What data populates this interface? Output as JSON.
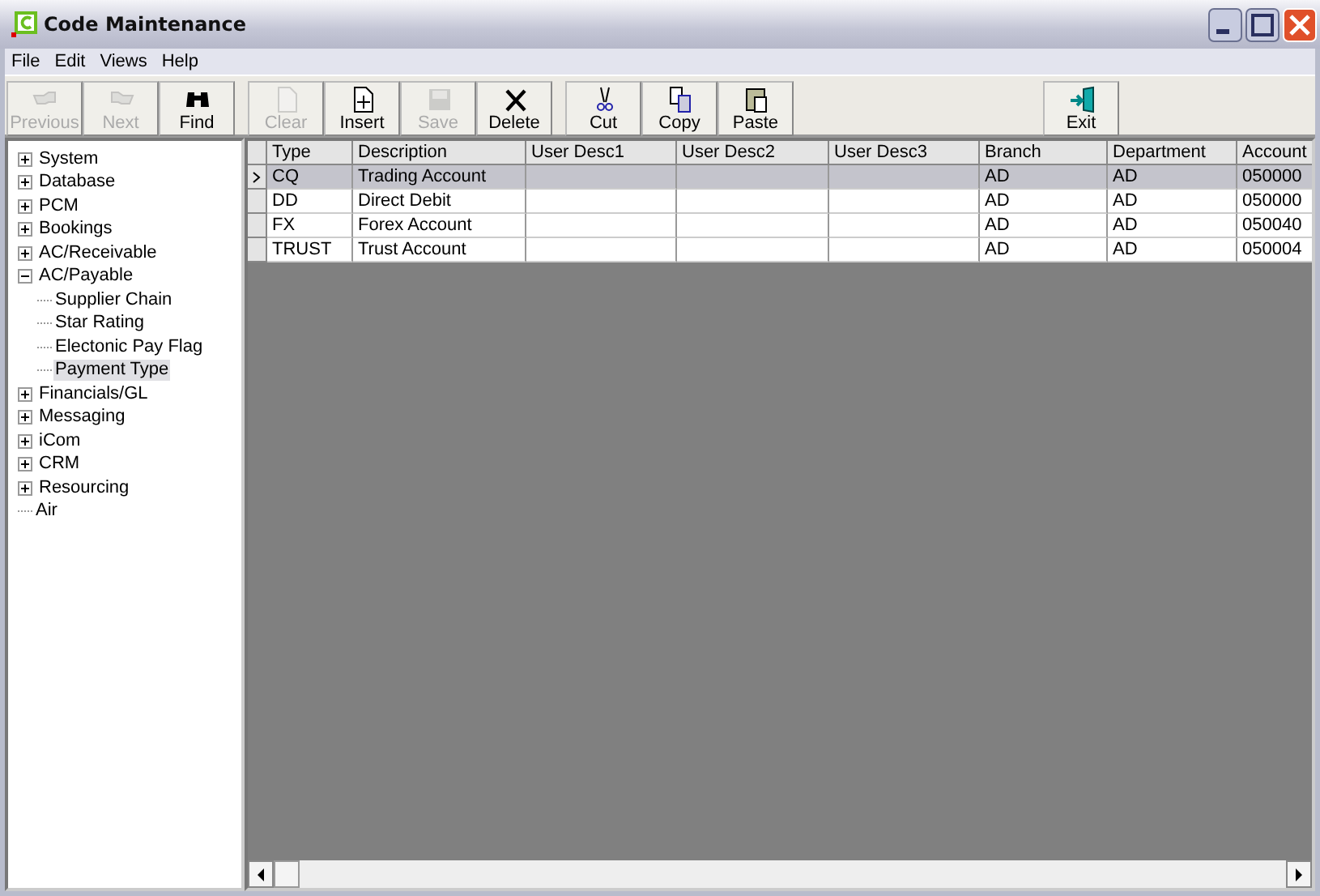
{
  "window": {
    "title": "Code Maintenance"
  },
  "menu": [
    "File",
    "Edit",
    "Views",
    "Help"
  ],
  "toolbar": [
    [
      {
        "label": "Previous",
        "disabled": true
      },
      {
        "label": "Next",
        "disabled": true
      },
      {
        "label": "Find",
        "disabled": false
      }
    ],
    [
      {
        "label": "Clear",
        "disabled": true
      },
      {
        "label": "Insert",
        "disabled": false
      },
      {
        "label": "Save",
        "disabled": true
      },
      {
        "label": "Delete",
        "disabled": false
      }
    ],
    [
      {
        "label": "Cut",
        "disabled": false
      },
      {
        "label": "Copy",
        "disabled": false
      },
      {
        "label": "Paste",
        "disabled": false
      }
    ],
    [
      {
        "label": "Exit",
        "disabled": false
      }
    ]
  ],
  "tree": [
    {
      "label": "System",
      "kind": "group",
      "expanded": false,
      "selected": false
    },
    {
      "label": "Database",
      "kind": "group",
      "expanded": false,
      "selected": false
    },
    {
      "label": "PCM",
      "kind": "group",
      "expanded": false,
      "selected": false
    },
    {
      "label": "Bookings",
      "kind": "group",
      "expanded": false,
      "selected": false
    },
    {
      "label": "AC/Receivable",
      "kind": "group",
      "expanded": false,
      "selected": false
    },
    {
      "label": "AC/Payable",
      "kind": "group",
      "expanded": true,
      "selected": false,
      "children": [
        {
          "label": "Supplier Chain",
          "kind": "leaf",
          "selected": false
        },
        {
          "label": "Star Rating",
          "kind": "leaf",
          "selected": false
        },
        {
          "label": "Electonic Pay Flag",
          "kind": "leaf",
          "selected": false
        },
        {
          "label": "Payment Type",
          "kind": "leaf",
          "selected": true
        }
      ]
    },
    {
      "label": "Financials/GL",
      "kind": "group",
      "expanded": false,
      "selected": false
    },
    {
      "label": "Messaging",
      "kind": "group",
      "expanded": false,
      "selected": false
    },
    {
      "label": "iCom",
      "kind": "group",
      "expanded": false,
      "selected": false
    },
    {
      "label": "CRM",
      "kind": "group",
      "expanded": false,
      "selected": false
    },
    {
      "label": "Resourcing",
      "kind": "group",
      "expanded": false,
      "selected": false
    },
    {
      "label": "Air",
      "kind": "leaf",
      "selected": false
    }
  ],
  "table": {
    "columns": [
      "Type",
      "Description",
      "User Desc1",
      "User Desc2",
      "User Desc3",
      "Branch",
      "Department",
      "Account"
    ],
    "rows": [
      {
        "selected": true,
        "cells": [
          "CQ",
          "Trading Account",
          null,
          null,
          null,
          "AD",
          "AD",
          "050000"
        ]
      },
      {
        "selected": false,
        "cells": [
          "DD",
          "Direct Debit",
          null,
          null,
          null,
          "AD",
          "AD",
          "050000"
        ]
      },
      {
        "selected": false,
        "cells": [
          "FX",
          "Forex Account",
          null,
          null,
          null,
          "AD",
          "AD",
          "050040"
        ]
      },
      {
        "selected": false,
        "cells": [
          "TRUST",
          "Trust Account",
          null,
          null,
          null,
          "AD",
          "AD",
          "050004"
        ]
      }
    ]
  }
}
